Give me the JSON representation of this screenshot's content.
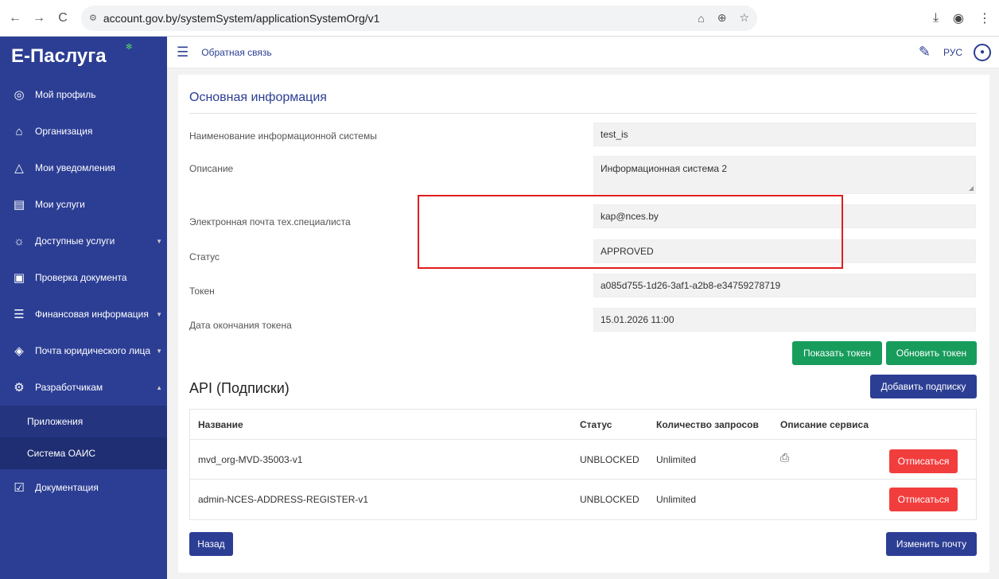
{
  "browser": {
    "back_icon": "←",
    "forward_icon": "→",
    "reload_icon": "C",
    "url": "account.gov.by/systemSystem/applicationSystemOrg/v1"
  },
  "sidebar": {
    "logo": "Е-Паслуга",
    "items": [
      {
        "label": "Мой профиль",
        "icon": "user-circle-icon"
      },
      {
        "label": "Организация",
        "icon": "building-icon"
      },
      {
        "label": "Мои уведомления",
        "icon": "bell-icon"
      },
      {
        "label": "Мои услуги",
        "icon": "document-list-icon"
      },
      {
        "label": "Доступные услуги",
        "icon": "hand-services-icon"
      },
      {
        "label": "Проверка документа",
        "icon": "document-check-icon"
      },
      {
        "label": "Финансовая информация",
        "icon": "database-icon"
      },
      {
        "label": "Почта юридического лица",
        "icon": "shield-mail-icon"
      },
      {
        "label": "Разработчикам",
        "icon": "gear-icon"
      }
    ],
    "sub_items": [
      {
        "label": "Приложения"
      },
      {
        "label": "Система ОАИС"
      }
    ],
    "docs": {
      "label": "Документация",
      "icon": "checkbox-icon"
    }
  },
  "topbar": {
    "feedback": "Обратная связь",
    "lang": "РУС"
  },
  "main": {
    "section_title": "Основная информация",
    "fields": [
      {
        "label": "Наименование информационной системы",
        "value": "test_is"
      },
      {
        "label": "Описание",
        "value": "Информационная система 2"
      },
      {
        "label": "Электронная почта тех.специалиста",
        "value": "kap@nces.by"
      },
      {
        "label": "Статус",
        "value": "APPROVED"
      },
      {
        "label": "Токен",
        "value": "a085d755-1d26-3af1-a2b8-e34759278719"
      },
      {
        "label": "Дата окончания токена",
        "value": "15.01.2026 11:00"
      }
    ],
    "show_token": "Показать токен",
    "refresh_token": "Обновить токен",
    "api_title": "API (Подписки)",
    "add_subscription": "Добавить подписку",
    "table": {
      "headers": [
        "Название",
        "Статус",
        "Количество запросов",
        "Описание сервиса"
      ],
      "rows": [
        {
          "name": "mvd_org-MVD-35003-v1",
          "status": "UNBLOCKED",
          "requests": "Unlimited",
          "has_doc": true,
          "action": "Отписаться"
        },
        {
          "name": "admin-NCES-ADDRESS-REGISTER-v1",
          "status": "UNBLOCKED",
          "requests": "Unlimited",
          "has_doc": false,
          "action": "Отписаться"
        }
      ]
    },
    "back": "Назад",
    "change_email": "Изменить почту"
  },
  "colors": {
    "sidebar": "#2c3e94",
    "green": "#179c5c",
    "red": "#f23d3d",
    "highlight": "#e11d1d"
  }
}
